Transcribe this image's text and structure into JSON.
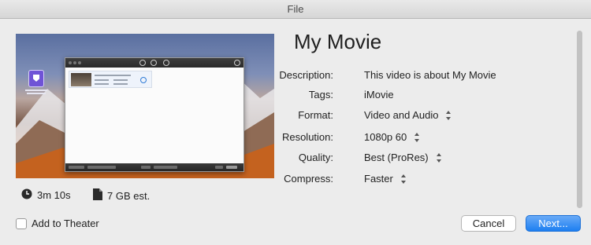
{
  "window": {
    "title": "File"
  },
  "preview": {
    "duration": "3m 10s",
    "size_estimate": "7 GB est.",
    "clock_icon": "clock-icon",
    "file_icon": "file-icon"
  },
  "movie": {
    "title": "My Movie",
    "fields": [
      {
        "label": "Description:",
        "value": "This video is about My Movie",
        "popup": false
      },
      {
        "label": "Tags:",
        "value": "iMovie",
        "popup": false
      },
      {
        "label": "Format:",
        "value": "Video and Audio",
        "popup": true
      },
      {
        "label": "Resolution:",
        "value": "1080p 60",
        "popup": true
      },
      {
        "label": "Quality:",
        "value": "Best (ProRes)",
        "popup": true
      },
      {
        "label": "Compress:",
        "value": "Faster",
        "popup": true
      }
    ]
  },
  "footer": {
    "add_to_theater_label": "Add to Theater",
    "add_to_theater_checked": false,
    "cancel_label": "Cancel",
    "next_label": "Next..."
  },
  "colors": {
    "accent": "#1d7ff1",
    "background": "#ececec"
  }
}
